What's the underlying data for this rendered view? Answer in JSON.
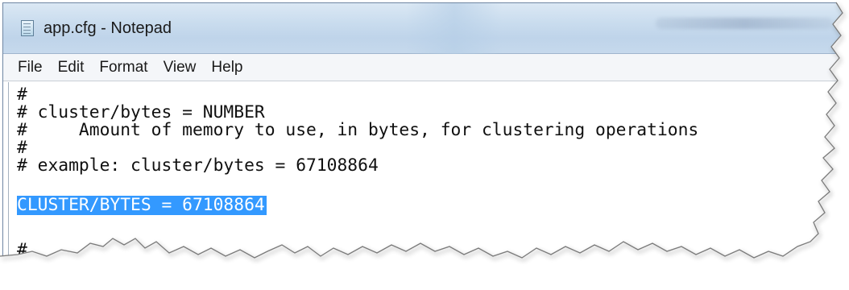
{
  "window": {
    "title": "app.cfg - Notepad",
    "icon": "notepad-icon"
  },
  "menu": {
    "items": [
      {
        "label": "File"
      },
      {
        "label": "Edit"
      },
      {
        "label": "Format"
      },
      {
        "label": "View"
      },
      {
        "label": "Help"
      }
    ]
  },
  "editor": {
    "lines": [
      "#",
      "# cluster/bytes = NUMBER",
      "#     Amount of memory to use, in bytes, for clustering operations",
      "#",
      "# example: cluster/bytes = 67108864",
      "",
      "CLUSTER/BYTES = 67108864",
      "#"
    ],
    "selected_line": 6,
    "selection_color": "#3399ff"
  }
}
